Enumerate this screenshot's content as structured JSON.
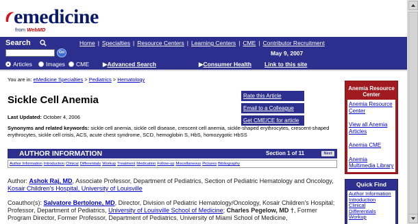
{
  "logo": {
    "wordmark": "emedicine",
    "reg": "®",
    "sub_prefix": "from ",
    "sub_brand": "WebMD"
  },
  "search": {
    "label": "Search",
    "go": "Go",
    "value": ""
  },
  "topnav": [
    "Home",
    "Specialties",
    "Resource Centers",
    "Learning Centers",
    "CME",
    "Contributor Recruitment"
  ],
  "date": "May 9, 2007",
  "filters": [
    {
      "label": "Articles",
      "selected": true
    },
    {
      "label": "Images",
      "selected": false
    },
    {
      "label": "CME",
      "selected": false
    }
  ],
  "advanced_search": "Advanced Search",
  "consumer_health": "Consumer Health",
  "link_to_site": "Link to this site",
  "breadcrumb": {
    "prefix": "You are in: ",
    "items": [
      "eMedicine Specialties",
      "Pediatrics",
      "Hematology"
    ],
    "sep": " > "
  },
  "article": {
    "title": "Sickle Cell Anemia",
    "updated_label": "Last Updated:",
    "updated_value": "October 4, 2006",
    "synonyms_label": "Synonyms and related keywords:",
    "synonyms_text": "sickle cell anemia, sickle cell disease, crescent cell anemia, sickle-shaped erythrocytes, crescent-shaped erythrocytes, sickle cell crisis, ACS, acute chest syndrome, SCD, hemoglobin S, HbS, homozygotic HbSS"
  },
  "actions": [
    "Rate this Article",
    "Email to a Colleague",
    "Get CME/CE for article"
  ],
  "section": {
    "label": "AUTHOR INFORMATION",
    "counter": "Section 1 of 11",
    "next": "Next"
  },
  "subnav": [
    "Author Information",
    "Introduction",
    "Clinical",
    "Differentials",
    "Workup",
    "Treatment",
    "Medication",
    "Follow-up",
    "Miscellaneous",
    "Pictures",
    "Bibliography"
  ],
  "author": {
    "label": "Author:",
    "name": "Ashok Raj, MD",
    "role": ", Associate Professor, Department of Pediatrics, Section of Pediatric Hematology and Oncology,",
    "affiliation": "Kosair Children's Hospital, University of Louisville"
  },
  "coauthors": {
    "label": "Coauthor(s):",
    "name1": "Salvatore Bertolone, MD",
    "role1": ", Director, Division of Pediatric Hematology/Oncology, Kosair Children's Hospital; Professor, Department of Pediatrics,",
    "affiliation1": "University of Louisville School of Medicine",
    "name2": "Charles Pegelow, MD †",
    "role2": ", Former Program Director, Former Professor, Department of Pediatrics, University of Miami School of Medicine,"
  },
  "resource_center": {
    "title": "Anemia Resource Center",
    "links": [
      "Anemia Resource Center",
      "View all Anemia Articles",
      "Anemia CME",
      "Anemia Multimedia Library"
    ]
  },
  "quick_find": {
    "title": "Quick Find",
    "links": [
      "Author Information",
      "Introduction",
      "Clinical",
      "Differentials",
      "Workup"
    ]
  }
}
